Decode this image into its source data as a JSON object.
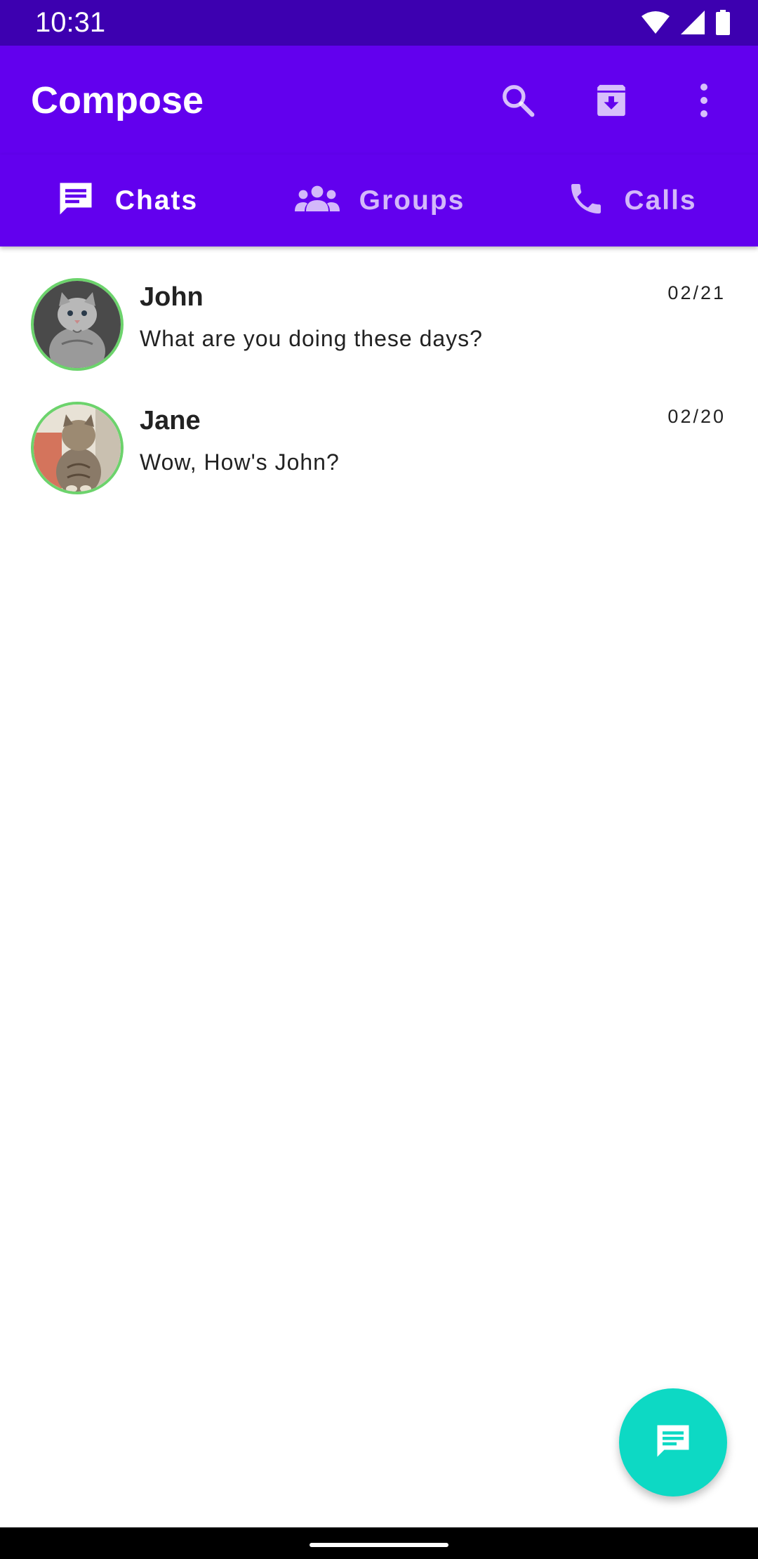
{
  "status_bar": {
    "time": "10:31",
    "icons": [
      "wifi-icon",
      "signal-icon",
      "battery-icon"
    ]
  },
  "app_bar": {
    "title": "Compose",
    "actions": [
      "search-icon",
      "archive-icon",
      "more-vert-icon"
    ]
  },
  "tabs": [
    {
      "label": "Chats",
      "icon": "chat-icon",
      "selected": true
    },
    {
      "label": "Groups",
      "icon": "groups-icon",
      "selected": false
    },
    {
      "label": "Calls",
      "icon": "phone-icon",
      "selected": false
    }
  ],
  "chats": [
    {
      "name": "John",
      "message": "What are you doing these days?",
      "date": "02/21",
      "avatar": "kitten-photo"
    },
    {
      "name": "Jane",
      "message": "Wow, How's John?",
      "date": "02/20",
      "avatar": "kitten-photo"
    }
  ],
  "fab": {
    "icon": "message-icon"
  },
  "colors": {
    "status_bar": "#3d00b0",
    "primary": "#6200ee",
    "fab": "#0dd9c4",
    "avatar_border": "#6cd36c"
  }
}
